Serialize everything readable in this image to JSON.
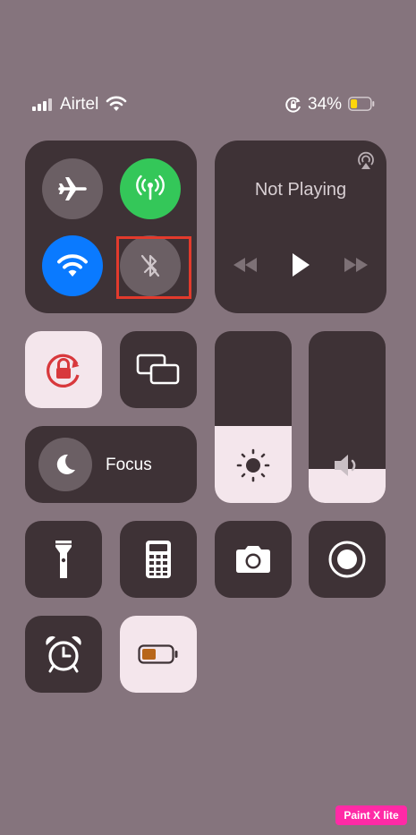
{
  "status_bar": {
    "carrier": "Airtel",
    "battery_percent": "34%",
    "battery_level": 0.34
  },
  "connectivity": {
    "airplane": {
      "icon": "airplane-icon",
      "on": false
    },
    "cellular": {
      "icon": "antenna-icon",
      "on": true
    },
    "wifi": {
      "icon": "wifi-icon",
      "on": true
    },
    "bluetooth": {
      "icon": "bluetooth-icon",
      "on": false
    }
  },
  "now_playing": {
    "title": "Not Playing",
    "airplay_icon": "airplay-icon"
  },
  "focus": {
    "label": "Focus",
    "icon": "moon-icon"
  },
  "brightness": {
    "level": 0.45,
    "icon": "sun-icon"
  },
  "volume": {
    "level": 0.2,
    "icon": "speaker-icon"
  },
  "shortcuts": [
    "flashlight-icon",
    "calculator-icon",
    "camera-icon",
    "screen-record-icon",
    "alarm-icon",
    "low-power-icon"
  ],
  "colors": {
    "background": "#85747d",
    "tile": "#3e3236",
    "tile_light": "#f4e6ec",
    "green": "#34c759",
    "blue": "#0a7aff",
    "highlight": "#e23a2c"
  },
  "watermark": "Paint X lite"
}
